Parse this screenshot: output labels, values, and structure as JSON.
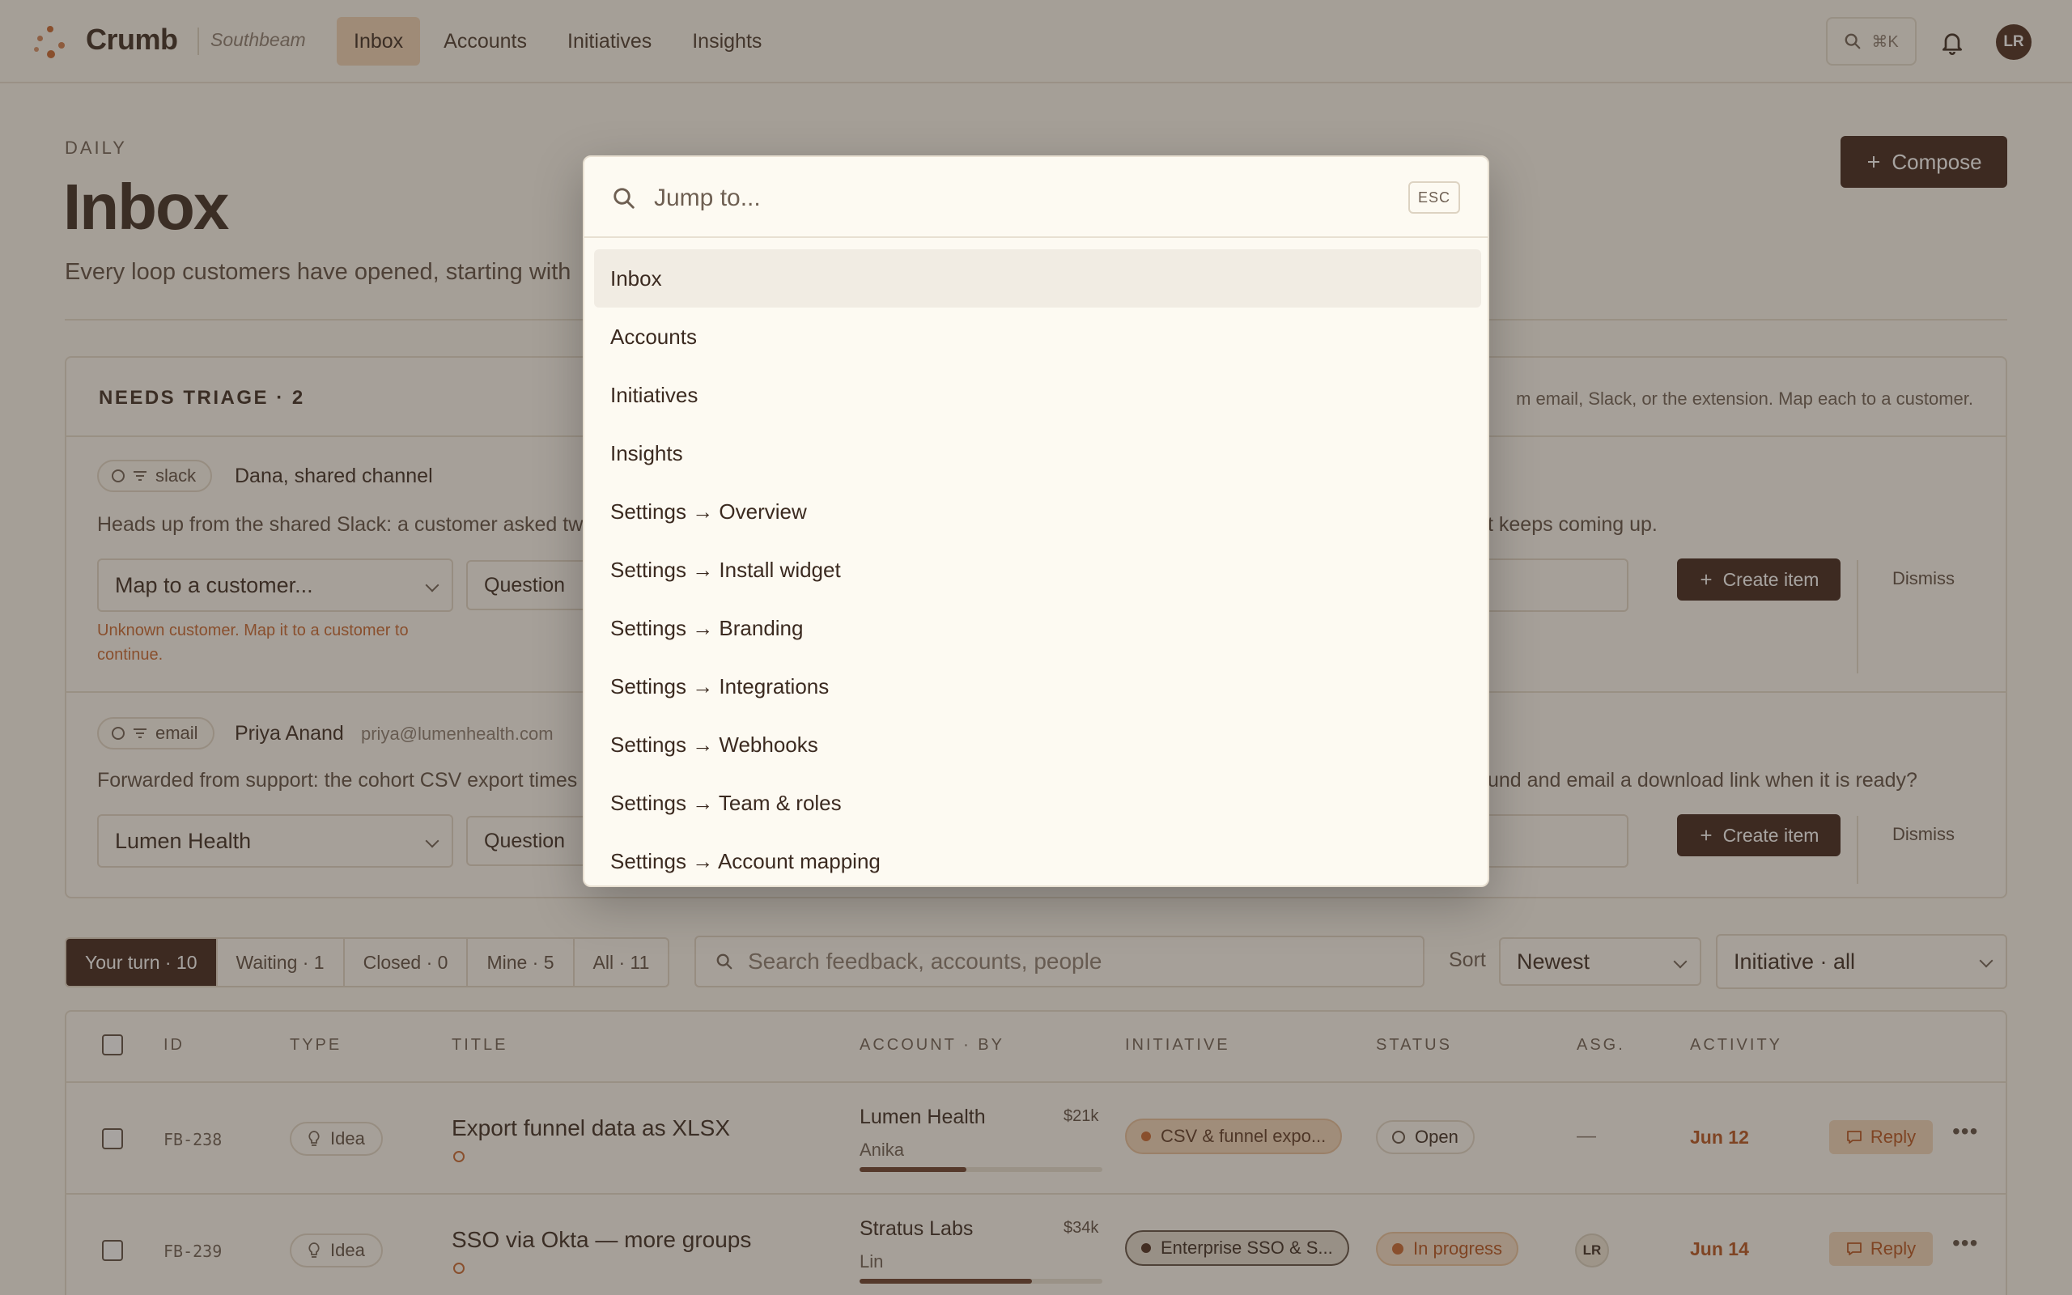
{
  "app": {
    "brand": "Crumb",
    "workspace": "Southbeam",
    "nav": [
      "Inbox",
      "Accounts",
      "Initiatives",
      "Insights"
    ],
    "search_shortcut": "⌘K",
    "user_initials": "LR",
    "accent_color": "#c8672f",
    "dark_color": "#3f2419"
  },
  "header": {
    "eyebrow": "DAILY",
    "title": "Inbox",
    "subtitle": "Every loop customers have opened, starting with",
    "compose_label": "Compose"
  },
  "triage": {
    "title": "NEEDS TRIAGE · 2",
    "hint": "m email, Slack, or the extension. Map each to a customer.",
    "items": [
      {
        "source": "slack",
        "from": "Dana, shared channel",
        "email": "",
        "message_left": "Heads up from the shared Slack: a customer asked tw",
        "message_right": "t keeps coming up.",
        "customer": "Map to a customer...",
        "type": "Question",
        "error": "Unknown customer. Map it to a customer to continue.",
        "create_label": "Create item",
        "dismiss_label": "Dismiss"
      },
      {
        "source": "email",
        "from": "Priya Anand",
        "email": "priya@lumenhealth.com",
        "message_left": "Forwarded from support: the cohort CSV export times",
        "message_right": "und and email a download link when it is ready?",
        "customer": "Lumen Health",
        "type": "Question",
        "error": "",
        "create_label": "Create item",
        "dismiss_label": "Dismiss"
      }
    ]
  },
  "filters": {
    "tabs": [
      "Your turn · 10",
      "Waiting · 1",
      "Closed · 0",
      "Mine · 5",
      "All · 11"
    ],
    "search_placeholder": "Search feedback, accounts, people",
    "sort_label": "Sort",
    "sort_value": "Newest",
    "initiative_value": "Initiative · all"
  },
  "table": {
    "columns": [
      "ID",
      "TYPE",
      "TITLE",
      "ACCOUNT · BY",
      "INITIATIVE",
      "STATUS",
      "ASG.",
      "ACTIVITY"
    ],
    "rows": [
      {
        "id": "FB-238",
        "type": "Idea",
        "title": "Export funnel data as XLSX",
        "account": "Lumen Health",
        "amount": "$21k",
        "by": "Anika",
        "bar_fraction": 0.44,
        "initiative": "CSV & funnel expo...",
        "initiative_color": "#c8672f",
        "status": "Open",
        "assignee": "—",
        "activity": "Jun  12",
        "reply_label": "Reply"
      },
      {
        "id": "FB-239",
        "type": "Idea",
        "title": "SSO via Okta — more groups",
        "account": "Stratus Labs",
        "amount": "$34k",
        "by": "Lin",
        "bar_fraction": 0.71,
        "initiative": "Enterprise SSO & S...",
        "initiative_color": "#4a2a1c",
        "status": "In progress",
        "assignee": "LR",
        "activity": "Jun  14",
        "reply_label": "Reply"
      }
    ]
  },
  "palette": {
    "placeholder": "Jump to...",
    "esc_label": "ESC",
    "items": [
      "Inbox",
      "Accounts",
      "Initiatives",
      "Insights",
      "Settings → Overview",
      "Settings → Install widget",
      "Settings → Branding",
      "Settings → Integrations",
      "Settings → Webhooks",
      "Settings → Team & roles",
      "Settings → Account mapping"
    ]
  }
}
